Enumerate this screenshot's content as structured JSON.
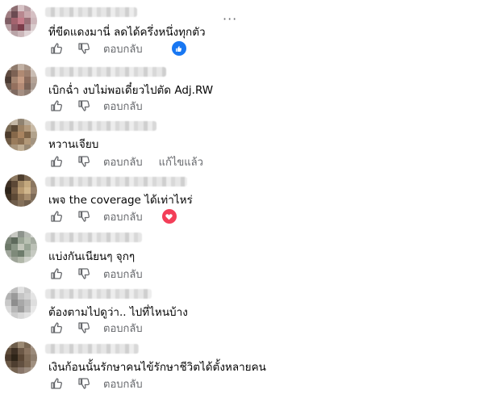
{
  "reply_label": "ตอบกลับ",
  "colors": {
    "like_blue": "#1877f2",
    "love_red": "#f33e58",
    "meta_gray": "#65676b"
  },
  "icons": {
    "like": "thumbs-up-icon",
    "dislike": "thumbs-down-icon",
    "more": "more-options-icon"
  },
  "comments": [
    {
      "text": "ที่ขีดแดงมานี่ ลดได้ครึ่งหนึ่งทุกตัว",
      "reaction": "like",
      "more": "···"
    },
    {
      "text": "เบิกฉ่ำ งบไม่พอเดี๋ยวไปตัด Adj.RW"
    },
    {
      "text": "หวานเจียบ",
      "edited": "แก้ไขแล้ว"
    },
    {
      "text": "เพจ the coverage ได้เท่าไหร่",
      "reaction": "love"
    },
    {
      "text": "แบ่งกันเนียนๆ จุกๆ"
    },
    {
      "text": "ต้องตามไปดูว่า.. ไปที่ไหนบ้าง"
    },
    {
      "text": "เงินก้อนนั้นรักษาคนไข้รักษาชีวิตได้ตั้งหลายคน"
    }
  ]
}
